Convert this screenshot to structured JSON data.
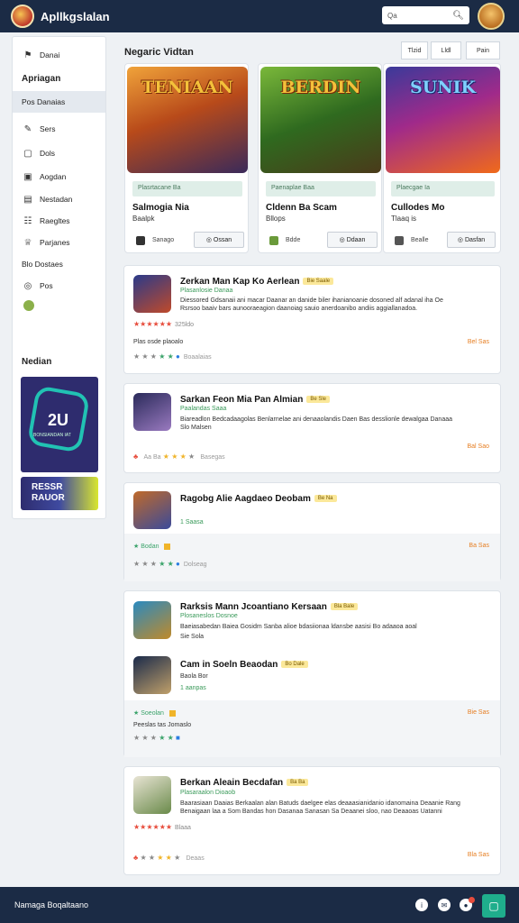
{
  "header": {
    "app_title": "Apllkgslalan",
    "search_placeholder": "Qa",
    "search_icon": "search-icon"
  },
  "sidebar": {
    "items": [
      {
        "label": "Danai",
        "icon": "pin-icon"
      },
      {
        "label": "Apriagan",
        "icon": ""
      },
      {
        "label": "Pos Danaias",
        "icon": ""
      },
      {
        "label": "Sers",
        "icon": "wrench-icon"
      },
      {
        "label": "Dols",
        "icon": "chat-icon"
      },
      {
        "label": "Aogdan",
        "icon": "chart-icon"
      },
      {
        "label": "Nestadan",
        "icon": "doc-icon"
      },
      {
        "label": "Raegltes",
        "icon": "grid-icon"
      },
      {
        "label": "Parjanes",
        "icon": "trophy-icon"
      },
      {
        "label": "Blo Dostaes",
        "icon": ""
      },
      {
        "label": "Pos",
        "icon": "circle-icon"
      }
    ],
    "promo_title": "Nedian",
    "promo_number": "2U",
    "promo_sub": "BONSIANDAN IAT",
    "promo_button": [
      "RESSR",
      "RAUOR"
    ]
  },
  "main": {
    "title": "Negaric Vidtan",
    "tabs": [
      "Tlzid",
      "Lldl",
      "Pain"
    ],
    "featured": [
      {
        "image_text": "TENIAAN",
        "tag": "Plasrtacane Ba",
        "name": "Salmogia Nia",
        "sub": "Baalpk",
        "type": "Sanago",
        "button": "Ossan"
      },
      {
        "image_text": "BERDIN",
        "tag": "Paenaplae Baa",
        "name": "Cldenn Ba Scam",
        "sub": "Bllops",
        "type": "Bdde",
        "button": "Ddaan"
      },
      {
        "image_text": "SUNIK",
        "tag": "Plaecgae Ia",
        "name": "Cullodes Mo",
        "sub": "Tlaaq is",
        "type": "Bealle",
        "button": "Dasfan"
      }
    ],
    "rows": [
      {
        "title": "Zerkan Man Kap Ko Aerlean",
        "badge": "Bie Saale",
        "sub": "Plasanlosie Danaa",
        "desc": [
          "Diessored Gdsanaii ani macar Daanar an danide biler ihanianoanie dosoned alf adanal iha Oe",
          "Rsrsoo baaiv bars aunooraeagion daanoiag sauio anerdoanibo andiis aggiallanadoa."
        ],
        "rating": "★★★★★★",
        "rating_count": "325ldo",
        "small": "Plas osde plaoalo",
        "price": "Bel Sas",
        "meta_count": "Boaalaias"
      },
      {
        "title": "Sarkan Feon Mia Pan Almian",
        "badge": "Be Sle",
        "sub": "Paalandas Saaa",
        "desc": [
          "Biareadlon Bedcadaagolas Benlarnelae ani denaaolandis Daen Bas desslionle dewalgaa Danaaa",
          "Slo Malsen"
        ],
        "rating": "♣",
        "rating_count": "Aa Ba",
        "price": "Bal Sao",
        "meta_count": "Basegas"
      },
      {
        "title": "Ragobg Alie Aagdaeo Deobam",
        "badge": "Be Na",
        "sub": "1 Saasa",
        "green": "Bodan",
        "price": "Ba Sas",
        "meta_count": "Dolseag"
      },
      {
        "title": "Rarksis Mann Jcoantiano Kersaan",
        "badge": "Bla Bale",
        "sub": "Plosaneslos Dosnoe",
        "desc": [
          "Baeiasabedan Baiea Gosidm Sanba alioe bdasiionaa ldansbe aasisi Bo adaaoa aoal"
        ],
        "small": "Sie Sola",
        "title2": "Cam in Soeln Beaodan",
        "badge2": "Bo Dale",
        "sub2": "Baola Bor",
        "sub3": "1 aanpas",
        "green": "Soeolan",
        "small2": "Peeslas tas Jomaslo",
        "price": "Bie Sas"
      },
      {
        "title": "Berkan Aleain Becdafan",
        "badge": "Ba Ba",
        "sub": "Plasaraalon Dioaob",
        "desc": [
          "Baarasiaan Daaias Berkaalan alan Batuds daelgee elas deaaasianidanio idanomaina Deaanie Rang",
          "Benaigaan laa a Som Bandas hon Dasanaa Sanasan Sa Deaanei sloo, nao Deaaoas Uatanni"
        ],
        "rating": "★★★★★★",
        "rating_count": "Blaaa",
        "price": "Bla Sas",
        "meta_count": "Deaas"
      }
    ]
  },
  "footer": {
    "text": "Namaga Boqaltaano"
  },
  "colors": {
    "header_bg": "#1b2b45",
    "accent_green": "#1fae8c",
    "star_red": "#e74c3c",
    "price_orange": "#e67e22"
  }
}
